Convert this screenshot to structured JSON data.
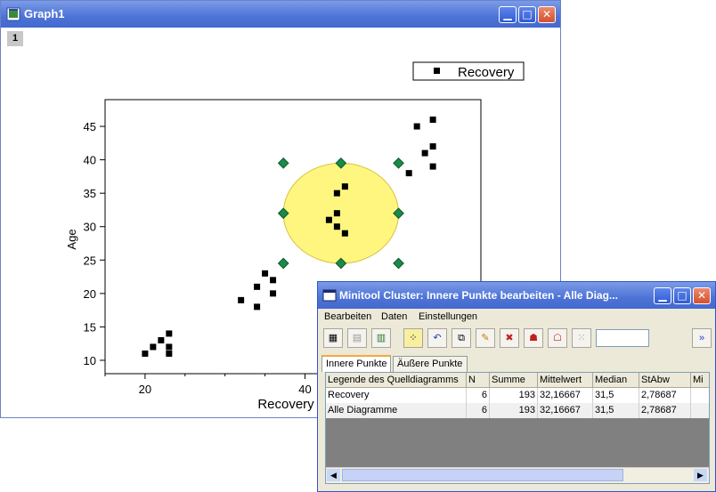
{
  "graph_window": {
    "title": "Graph1",
    "page_tab": "1"
  },
  "chart_data": {
    "type": "scatter",
    "title": "",
    "xlabel": "Recovery",
    "ylabel": "Age",
    "xlim": [
      15,
      62
    ],
    "ylim": [
      8,
      49
    ],
    "x_ticks": [
      20,
      40
    ],
    "y_ticks": [
      10,
      15,
      20,
      25,
      30,
      35,
      40,
      45
    ],
    "legend": {
      "label": "Recovery",
      "placement": "top-right"
    },
    "series": [
      {
        "name": "Recovery",
        "color": "#000000",
        "points": [
          [
            20,
            11
          ],
          [
            21,
            12
          ],
          [
            22,
            13
          ],
          [
            23,
            14
          ],
          [
            23,
            12
          ],
          [
            23,
            11
          ],
          [
            32,
            19
          ],
          [
            34,
            21
          ],
          [
            34,
            18
          ],
          [
            35,
            23
          ],
          [
            36,
            22
          ],
          [
            36,
            20
          ],
          [
            43,
            31
          ],
          [
            44,
            32
          ],
          [
            44,
            35
          ],
          [
            44,
            30
          ],
          [
            45,
            36
          ],
          [
            45,
            29
          ],
          [
            53,
            38
          ],
          [
            54,
            45
          ],
          [
            55,
            41
          ],
          [
            56,
            46
          ],
          [
            56,
            42
          ],
          [
            56,
            39
          ]
        ]
      }
    ],
    "selection_ellipse": {
      "center": [
        44.5,
        32
      ],
      "radius_x": 7.2,
      "radius_y": 7.5,
      "fill": "#fff680",
      "stroke": "#d8c040",
      "handle_color": "#1a8a4a"
    }
  },
  "mini_window": {
    "title": "Minitool Cluster: Innere Punkte bearbeiten - Alle Diag...",
    "menu": [
      "Bearbeiten",
      "Daten",
      "Einstellungen"
    ],
    "toolbar_icons": [
      "worksheet-icon",
      "add-column-icon",
      "table-icon",
      "mask-icon",
      "undo-icon",
      "copy-icon",
      "pencil-icon",
      "delete-points-icon",
      "extract-icon",
      "extract-all-icon",
      "scatter-points-icon"
    ],
    "toolbar_input_value": "",
    "tabs": [
      "Innere Punkte",
      "Äußere Punkte"
    ],
    "columns": [
      "Legende des Quelldiagramms",
      "N",
      "Summe",
      "Mittelwert",
      "Median",
      "StAbw",
      "Mi"
    ],
    "rows": [
      [
        "Recovery",
        "6",
        "193",
        "32,16667",
        "31,5",
        "2,78687",
        ""
      ],
      [
        "Alle Diagramme",
        "6",
        "193",
        "32,16667",
        "31,5",
        "2,78687",
        ""
      ]
    ]
  },
  "colors": {
    "titlebar": "#4a6fd6",
    "window_face": "#ece9d8",
    "close_button": "#d3502c"
  }
}
